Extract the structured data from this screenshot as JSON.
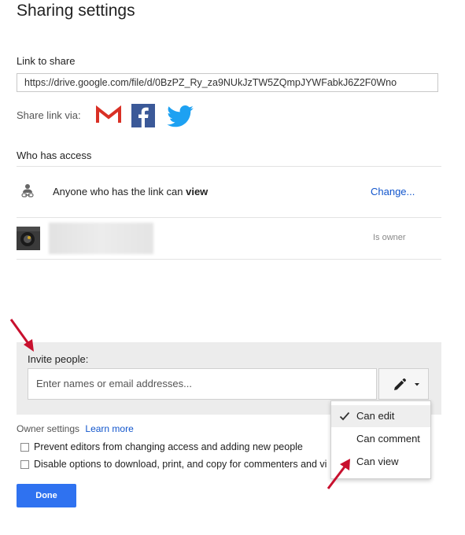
{
  "dialog": {
    "title": "Sharing settings"
  },
  "link_section": {
    "label": "Link to share",
    "url": "https://drive.google.com/file/d/0BzPZ_Ry_za9NUkJzTW5ZQmpJYWFabkJ6Z2F0Wno",
    "share_via_label": "Share link via:",
    "share_icons": [
      "gmail-icon",
      "facebook-icon",
      "twitter-icon"
    ],
    "colors": {
      "gmail": "#d93025",
      "facebook": "#3b5998",
      "twitter": "#1da1f2"
    }
  },
  "access": {
    "label": "Who has access",
    "rows": [
      {
        "icon": "link-person-icon",
        "text_prefix": "Anyone who has the link can ",
        "text_bold": "view",
        "action": "Change..."
      },
      {
        "icon": "avatar",
        "role": "Is owner"
      }
    ]
  },
  "invite": {
    "label": "Invite people:",
    "placeholder": "Enter names or email addresses...",
    "permission_icon": "pencil-icon",
    "dropdown": {
      "options": [
        "Can edit",
        "Can comment",
        "Can view"
      ],
      "selected": "Can edit"
    }
  },
  "owner_settings": {
    "label": "Owner settings",
    "learn_more": "Learn more",
    "options": [
      {
        "label": "Prevent editors from changing access and adding new people",
        "checked": false
      },
      {
        "label": "Disable options to download, print, and copy for commenters and vi",
        "checked": false
      }
    ]
  },
  "actions": {
    "done": "Done"
  },
  "accent_color": "#2f72f0",
  "annotation_color": "#c8102e"
}
